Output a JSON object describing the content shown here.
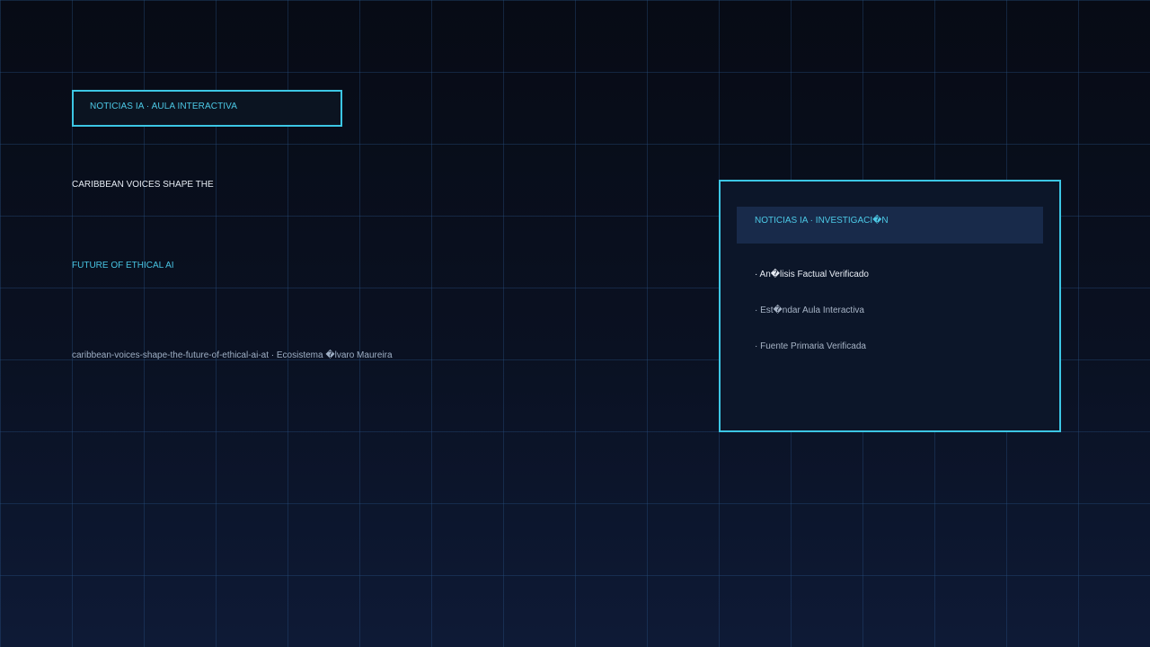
{
  "colors": {
    "accent": "#3cc6e4",
    "background_top": "#070b15",
    "background_bottom": "#0e1a36",
    "panel_header": "#182a4a"
  },
  "badge": {
    "label": "NOTICIAS IA · AULA INTERACTIVA"
  },
  "headline": {
    "line1": "CARIBBEAN VOICES SHAPE THE",
    "line2": "FUTURE OF ETHICAL AI"
  },
  "slug": "caribbean-voices-shape-the-future-of-ethical-ai-at · Ecosistema �lvaro Maureira",
  "panel": {
    "header": "NOTICIAS IA · INVESTIGACI�N",
    "items": [
      "· An�lisis Factual Verificado",
      "· Est�ndar Aula Interactiva",
      "· Fuente Primaria Verificada"
    ]
  }
}
